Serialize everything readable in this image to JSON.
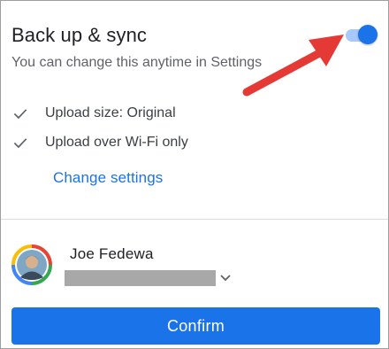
{
  "backup": {
    "title": "Back up & sync",
    "subtitle": "You can change this anytime in Settings",
    "toggle_on": true
  },
  "settings_summary": [
    {
      "icon": "check-icon",
      "label": "Upload size: Original"
    },
    {
      "icon": "check-icon",
      "label": "Upload over Wi-Fi only"
    }
  ],
  "change_settings_label": "Change settings",
  "account": {
    "name": "Joe Fedewa",
    "email_redacted": true
  },
  "confirm_label": "Confirm",
  "colors": {
    "accent": "#1a73e8",
    "toggle_track": "#a8c7fa",
    "annotation_arrow": "#e53935"
  }
}
